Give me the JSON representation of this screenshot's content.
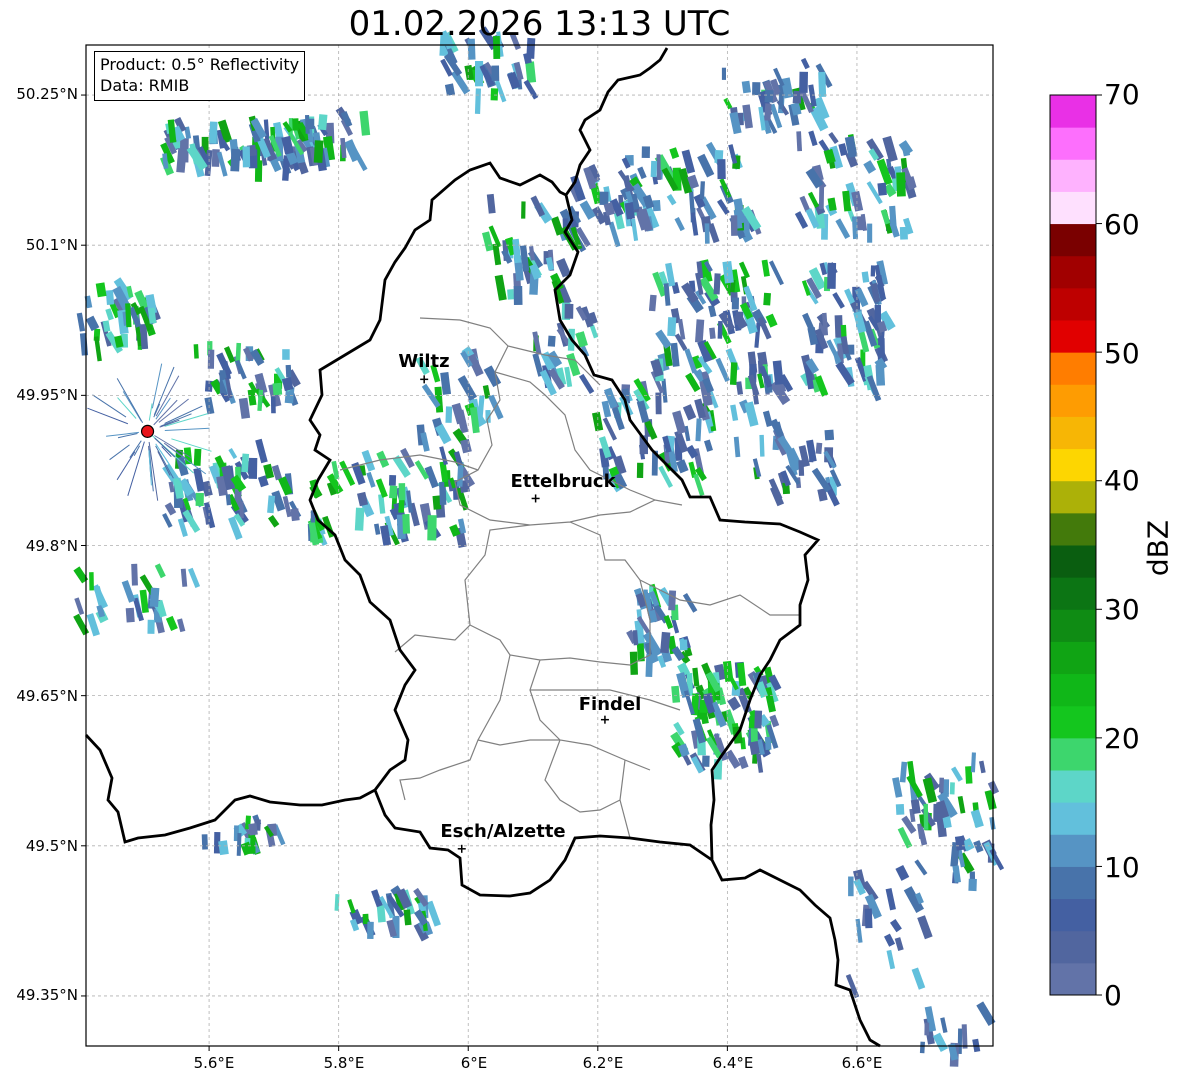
{
  "title": "01.02.2026 13:13 UTC",
  "info_box": {
    "product": "Product: 0.5° Reflectivity",
    "data": "Data: RMIB"
  },
  "map": {
    "lon_range": [
      5.41,
      6.81
    ],
    "lat_range": [
      49.3,
      50.3
    ],
    "lat_ticks": [
      "50.25°N",
      "50.1°N",
      "49.95°N",
      "49.8°N",
      "49.65°N",
      "49.5°N",
      "49.35°N"
    ],
    "lon_ticks": [
      "5.6°E",
      "5.8°E",
      "6°E",
      "6.2°E",
      "6.4°E",
      "6.6°E"
    ],
    "radar_site": {
      "lon": 5.505,
      "lat": 49.914,
      "color": "#e8141a"
    },
    "cities": [
      {
        "name": "Wiltz",
        "lon": 5.932,
        "lat": 49.966
      },
      {
        "name": "Ettelbruck",
        "lon": 6.104,
        "lat": 49.847
      },
      {
        "name": "Findel",
        "lon": 6.211,
        "lat": 49.626
      },
      {
        "name": "Esch/Alzette",
        "lon": 5.99,
        "lat": 49.497
      }
    ]
  },
  "colorbar": {
    "label": "dBZ",
    "ticks": [
      "70",
      "60",
      "50",
      "40",
      "30",
      "20",
      "10",
      "0"
    ],
    "min": 0,
    "max": 70,
    "colors": [
      "#6273a8",
      "#51669f",
      "#4460a2",
      "#4873aa",
      "#5694c4",
      "#62c0dc",
      "#5dd6c8",
      "#3dd66d",
      "#14c61e",
      "#10b718",
      "#10a414",
      "#0f8c14",
      "#0c7514",
      "#0a5e10",
      "#437a0b",
      "#acb108",
      "#fdd601",
      "#f7b605",
      "#fe9c02",
      "#ff7d00",
      "#e10000",
      "#be0000",
      "#a10000",
      "#7a0000",
      "#fee0fe",
      "#feb2fe",
      "#fd6ffd",
      "#e930e6"
    ]
  }
}
